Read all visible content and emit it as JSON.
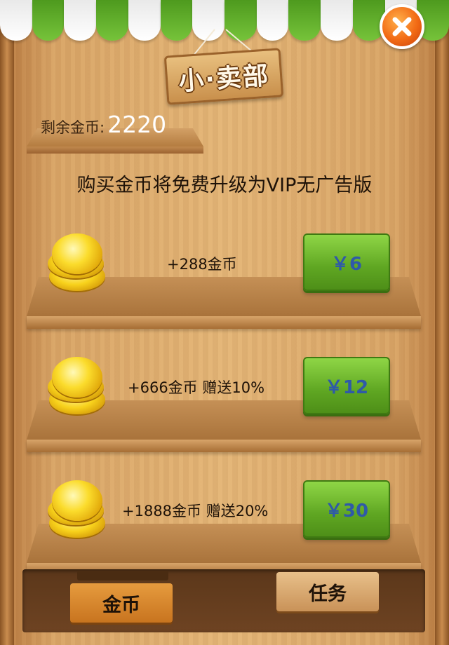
{
  "header": {
    "sign_title": "小·卖部",
    "close_icon": "close-icon"
  },
  "balance": {
    "label": "剩余金币:",
    "value": "2220"
  },
  "promo": {
    "text": "购买金币将免费升级为VIP无广告版"
  },
  "items": [
    {
      "amount": "+288金币",
      "price": "￥6"
    },
    {
      "amount": "+666金币  赠送10%",
      "price": "￥12"
    },
    {
      "amount": "+1888金币  赠送20%",
      "price": "￥30"
    }
  ],
  "tabs": {
    "gold": "金币",
    "tasks": "任务"
  },
  "colors": {
    "awning_green": "#5fa622",
    "price_button": "#6fbf2c",
    "price_text": "#2f5aa8",
    "close_button": "#f26a14"
  }
}
